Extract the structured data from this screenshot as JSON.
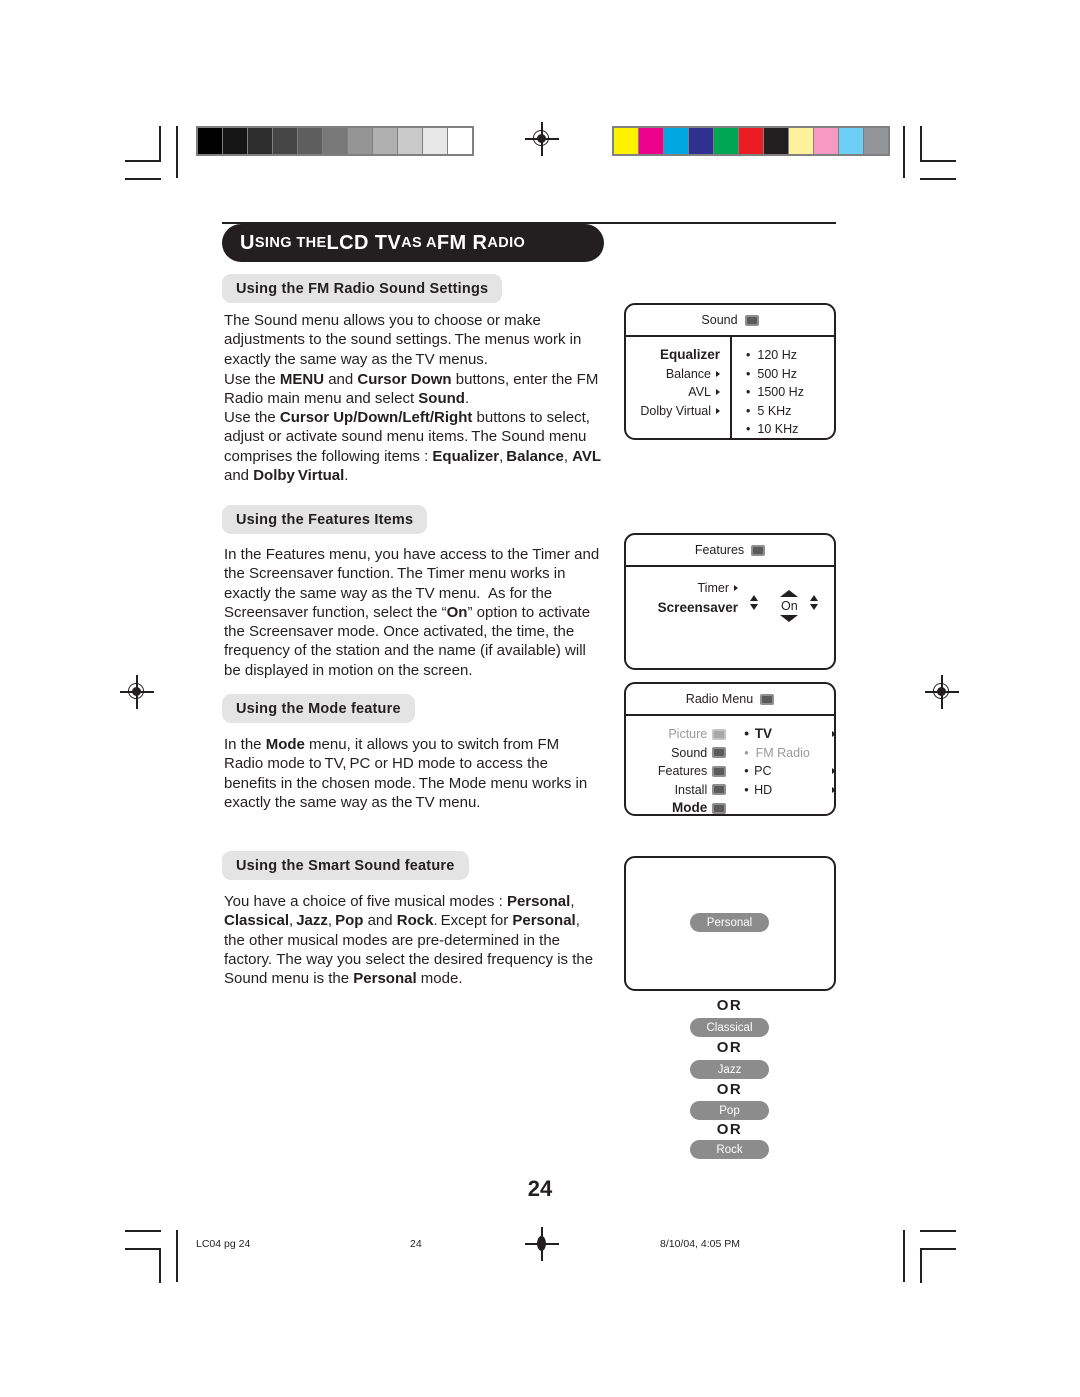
{
  "document": {
    "title_banner": {
      "part1": "U",
      "part2": "SING THE",
      "part3": " LCD TV ",
      "part4": "AS A",
      "part5": " FM R",
      "part6": "ADIO"
    },
    "page_number": "24"
  },
  "sections": [
    {
      "heading": "Using the FM Radio Sound Settings",
      "paragraphs": [
        "The Sound menu allows you to choose or make adjustments to the sound settings. The menus work in exactly the same way as the TV menus.",
        "Use the MENU and Cursor Down buttons, enter the FM Radio main menu and select Sound.",
        "Use the Cursor Up/Down/Left/Right buttons to select, adjust or activate sound menu items. The Sound menu comprises the following items : Equalizer, Balance, AVL and Dolby Virtual."
      ]
    },
    {
      "heading": "Using the Features Items",
      "paragraphs": [
        "In the Features menu, you have access to the Timer and the Screensaver function. The Timer menu works in exactly the same way as the TV menu. As for the Screensaver function, select the “On” option to activate the Screensaver mode. Once activated, the time, the frequency of the station and the name (if available) will be displayed in motion on the screen."
      ]
    },
    {
      "heading": "Using the Mode feature",
      "paragraphs": [
        "In the Mode menu, it allows you to switch from FM Radio mode to TV, PC or HD mode to access the benefits in the chosen mode. The Mode menu works in exactly the same way as the TV menu."
      ]
    },
    {
      "heading": "Using the Smart Sound feature",
      "paragraphs": [
        "You have a choice of five musical modes : Personal, Classical, Jazz, Pop and Rock. Except for Personal, the other musical modes are pre-determined in the factory. The way you select the desired frequency is the Sound menu is the Personal mode."
      ]
    }
  ],
  "osd_sound": {
    "header": "Sound",
    "header_icon": "speaker-icon",
    "left_items": [
      {
        "label": "Equalizer",
        "selected": true,
        "arrow": false,
        "dim": false
      },
      {
        "label": "Balance",
        "selected": false,
        "arrow": true,
        "dim": false
      },
      {
        "label": "AVL",
        "selected": false,
        "arrow": true,
        "dim": false
      },
      {
        "label": "Dolby Virtual",
        "selected": false,
        "arrow": true,
        "dim": false
      }
    ],
    "right_items": [
      "120 Hz",
      "500 Hz",
      "1500 Hz",
      "5 KHz",
      "10 KHz"
    ]
  },
  "osd_features": {
    "header": "Features",
    "header_icon": "features-icon",
    "timer_label": "Timer",
    "screensaver_label": "Screensaver",
    "screensaver_value": "On"
  },
  "osd_radio_menu": {
    "header": "Radio Menu",
    "header_icon": "radio-menu-icon",
    "left_items": [
      {
        "label": "Picture",
        "dim": true,
        "selected": false
      },
      {
        "label": "Sound",
        "dim": false,
        "selected": false
      },
      {
        "label": "Features",
        "dim": false,
        "selected": false
      },
      {
        "label": "Install",
        "dim": false,
        "selected": false
      },
      {
        "label": "Mode",
        "dim": false,
        "selected": true
      }
    ],
    "right_items": [
      {
        "label": "TV",
        "dim": false,
        "selected": true,
        "arrow": true
      },
      {
        "label": "FM Radio",
        "dim": true,
        "selected": false,
        "arrow": false
      },
      {
        "label": "PC",
        "dim": false,
        "selected": false,
        "arrow": true
      },
      {
        "label": "HD",
        "dim": false,
        "selected": false,
        "arrow": true
      }
    ]
  },
  "smart_sound": {
    "primary_badge": "Personal",
    "or_label": "OR",
    "alternatives": [
      "Classical",
      "Jazz",
      "Pop",
      "Rock"
    ]
  },
  "footer": {
    "file_slug": "LC04 pg 24",
    "page_slug": "24",
    "timestamp": "8/10/04, 4:05 PM"
  },
  "calibration": {
    "gray_steps": [
      "#000000",
      "#151515",
      "#2d2d2d",
      "#454545",
      "#5e5e5e",
      "#787878",
      "#959595",
      "#b0b0b0",
      "#c9c9c9",
      "#e8e8e8",
      "#ffffff"
    ],
    "color_steps": [
      "#fff200",
      "#ec008c",
      "#00a7e1",
      "#2e3192",
      "#00a651",
      "#ed1c24",
      "#231f20",
      "#fdf19c",
      "#f79ac3",
      "#6dcff6",
      "#939598"
    ]
  }
}
